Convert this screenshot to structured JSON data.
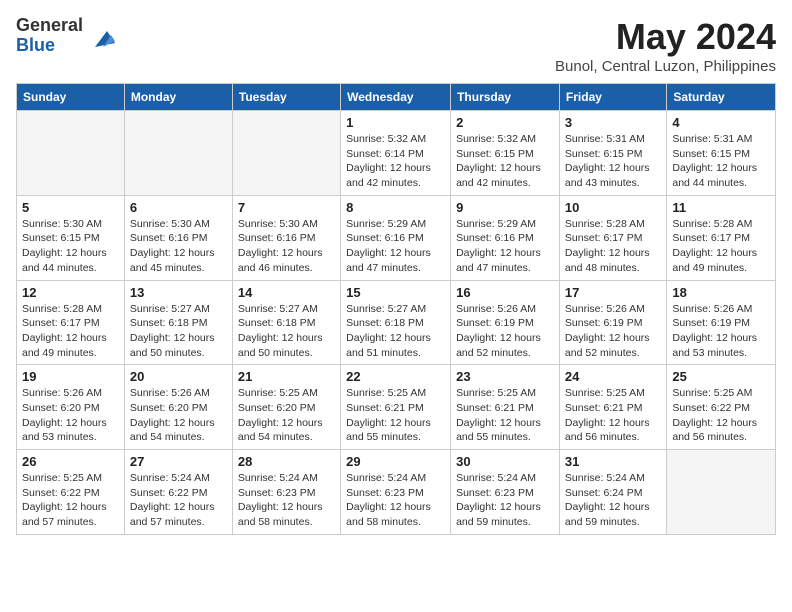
{
  "logo": {
    "general": "General",
    "blue": "Blue"
  },
  "title": "May 2024",
  "location": "Bunol, Central Luzon, Philippines",
  "weekdays": [
    "Sunday",
    "Monday",
    "Tuesday",
    "Wednesday",
    "Thursday",
    "Friday",
    "Saturday"
  ],
  "weeks": [
    [
      {
        "day": "",
        "info": ""
      },
      {
        "day": "",
        "info": ""
      },
      {
        "day": "",
        "info": ""
      },
      {
        "day": "1",
        "info": "Sunrise: 5:32 AM\nSunset: 6:14 PM\nDaylight: 12 hours\nand 42 minutes."
      },
      {
        "day": "2",
        "info": "Sunrise: 5:32 AM\nSunset: 6:15 PM\nDaylight: 12 hours\nand 42 minutes."
      },
      {
        "day": "3",
        "info": "Sunrise: 5:31 AM\nSunset: 6:15 PM\nDaylight: 12 hours\nand 43 minutes."
      },
      {
        "day": "4",
        "info": "Sunrise: 5:31 AM\nSunset: 6:15 PM\nDaylight: 12 hours\nand 44 minutes."
      }
    ],
    [
      {
        "day": "5",
        "info": "Sunrise: 5:30 AM\nSunset: 6:15 PM\nDaylight: 12 hours\nand 44 minutes."
      },
      {
        "day": "6",
        "info": "Sunrise: 5:30 AM\nSunset: 6:16 PM\nDaylight: 12 hours\nand 45 minutes."
      },
      {
        "day": "7",
        "info": "Sunrise: 5:30 AM\nSunset: 6:16 PM\nDaylight: 12 hours\nand 46 minutes."
      },
      {
        "day": "8",
        "info": "Sunrise: 5:29 AM\nSunset: 6:16 PM\nDaylight: 12 hours\nand 47 minutes."
      },
      {
        "day": "9",
        "info": "Sunrise: 5:29 AM\nSunset: 6:16 PM\nDaylight: 12 hours\nand 47 minutes."
      },
      {
        "day": "10",
        "info": "Sunrise: 5:28 AM\nSunset: 6:17 PM\nDaylight: 12 hours\nand 48 minutes."
      },
      {
        "day": "11",
        "info": "Sunrise: 5:28 AM\nSunset: 6:17 PM\nDaylight: 12 hours\nand 49 minutes."
      }
    ],
    [
      {
        "day": "12",
        "info": "Sunrise: 5:28 AM\nSunset: 6:17 PM\nDaylight: 12 hours\nand 49 minutes."
      },
      {
        "day": "13",
        "info": "Sunrise: 5:27 AM\nSunset: 6:18 PM\nDaylight: 12 hours\nand 50 minutes."
      },
      {
        "day": "14",
        "info": "Sunrise: 5:27 AM\nSunset: 6:18 PM\nDaylight: 12 hours\nand 50 minutes."
      },
      {
        "day": "15",
        "info": "Sunrise: 5:27 AM\nSunset: 6:18 PM\nDaylight: 12 hours\nand 51 minutes."
      },
      {
        "day": "16",
        "info": "Sunrise: 5:26 AM\nSunset: 6:19 PM\nDaylight: 12 hours\nand 52 minutes."
      },
      {
        "day": "17",
        "info": "Sunrise: 5:26 AM\nSunset: 6:19 PM\nDaylight: 12 hours\nand 52 minutes."
      },
      {
        "day": "18",
        "info": "Sunrise: 5:26 AM\nSunset: 6:19 PM\nDaylight: 12 hours\nand 53 minutes."
      }
    ],
    [
      {
        "day": "19",
        "info": "Sunrise: 5:26 AM\nSunset: 6:20 PM\nDaylight: 12 hours\nand 53 minutes."
      },
      {
        "day": "20",
        "info": "Sunrise: 5:26 AM\nSunset: 6:20 PM\nDaylight: 12 hours\nand 54 minutes."
      },
      {
        "day": "21",
        "info": "Sunrise: 5:25 AM\nSunset: 6:20 PM\nDaylight: 12 hours\nand 54 minutes."
      },
      {
        "day": "22",
        "info": "Sunrise: 5:25 AM\nSunset: 6:21 PM\nDaylight: 12 hours\nand 55 minutes."
      },
      {
        "day": "23",
        "info": "Sunrise: 5:25 AM\nSunset: 6:21 PM\nDaylight: 12 hours\nand 55 minutes."
      },
      {
        "day": "24",
        "info": "Sunrise: 5:25 AM\nSunset: 6:21 PM\nDaylight: 12 hours\nand 56 minutes."
      },
      {
        "day": "25",
        "info": "Sunrise: 5:25 AM\nSunset: 6:22 PM\nDaylight: 12 hours\nand 56 minutes."
      }
    ],
    [
      {
        "day": "26",
        "info": "Sunrise: 5:25 AM\nSunset: 6:22 PM\nDaylight: 12 hours\nand 57 minutes."
      },
      {
        "day": "27",
        "info": "Sunrise: 5:24 AM\nSunset: 6:22 PM\nDaylight: 12 hours\nand 57 minutes."
      },
      {
        "day": "28",
        "info": "Sunrise: 5:24 AM\nSunset: 6:23 PM\nDaylight: 12 hours\nand 58 minutes."
      },
      {
        "day": "29",
        "info": "Sunrise: 5:24 AM\nSunset: 6:23 PM\nDaylight: 12 hours\nand 58 minutes."
      },
      {
        "day": "30",
        "info": "Sunrise: 5:24 AM\nSunset: 6:23 PM\nDaylight: 12 hours\nand 59 minutes."
      },
      {
        "day": "31",
        "info": "Sunrise: 5:24 AM\nSunset: 6:24 PM\nDaylight: 12 hours\nand 59 minutes."
      },
      {
        "day": "",
        "info": ""
      }
    ]
  ]
}
